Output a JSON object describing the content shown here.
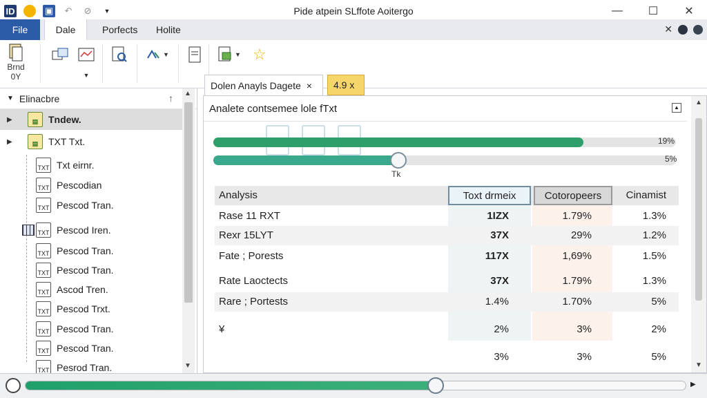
{
  "window": {
    "title": "Pide atpein SLffote Aoitergo"
  },
  "quick_access": [
    "app-icon",
    "sun-icon",
    "save-icon",
    "undo-icon",
    "redo-icon"
  ],
  "tabs": {
    "file": "File",
    "active": "Dale",
    "t3": "Porfects",
    "t4": "Holite"
  },
  "ribbon": {
    "first_label_line1": "Brnd",
    "first_label_line2": "0Y"
  },
  "tree": {
    "header": "Elinacbre",
    "items": [
      {
        "label": "Tndew.",
        "icon": "TXT",
        "expander": "▶",
        "selected": true
      },
      {
        "label": "TXT Txt.",
        "icon": "TXT",
        "expander": "▶"
      },
      {
        "label": "Txt eirnr.",
        "icon": "TXT"
      },
      {
        "label": "Pescodian",
        "icon": "TXT"
      },
      {
        "label": "Pescod Tran.",
        "icon": "TXT"
      },
      {
        "label": "Pescod Iren.",
        "icon": "TXT"
      },
      {
        "label": "Pescod Tran.",
        "icon": "TXT"
      },
      {
        "label": "Pescod Tran.",
        "icon": "TXT"
      },
      {
        "label": "Ascod Tren.",
        "icon": "TXT"
      },
      {
        "label": "Pescod Trxt.",
        "icon": "TXT"
      },
      {
        "label": "Pescod Tran.",
        "icon": "TXT"
      },
      {
        "label": "Pescod Tran.",
        "icon": "TXT"
      },
      {
        "label": "Pesrod Tran.",
        "icon": "TXT"
      }
    ]
  },
  "doc_tabs": {
    "active": "Dolen Anayls Dagete",
    "close": "×",
    "secondary": "4.9 x"
  },
  "main": {
    "header": "Analete contsemee lole fTxt",
    "progress1": {
      "value": 0.8,
      "label": "19%",
      "color": "#2e9e6a"
    },
    "progress2": {
      "value": 0.4,
      "label": "5%",
      "color": "#3aa88a",
      "knob_label": "Tk"
    },
    "table": {
      "headers": [
        "Analysis",
        "Toxt drmeix",
        "Cotoropeers",
        "Cinamist"
      ],
      "rows": [
        [
          "Rase 11 RXT",
          "1IZX",
          "1.79%",
          "1.3%"
        ],
        [
          "Rexr 15LYT",
          "37X",
          "29%",
          "1.2%"
        ],
        [
          "Fate ; Porests",
          "117X",
          "1,69%",
          "1.5%"
        ],
        [
          "Rate Laoctects",
          "37X",
          "1.79%",
          "1.3%"
        ],
        [
          "Rare ; Portests",
          "1.4%",
          "1.70%",
          "5%"
        ],
        [
          "¥",
          "2%",
          "3%",
          "2%"
        ],
        [
          "",
          "3%",
          "3%",
          "5%"
        ]
      ]
    }
  },
  "bottom": {
    "slider_value": 0.62
  }
}
